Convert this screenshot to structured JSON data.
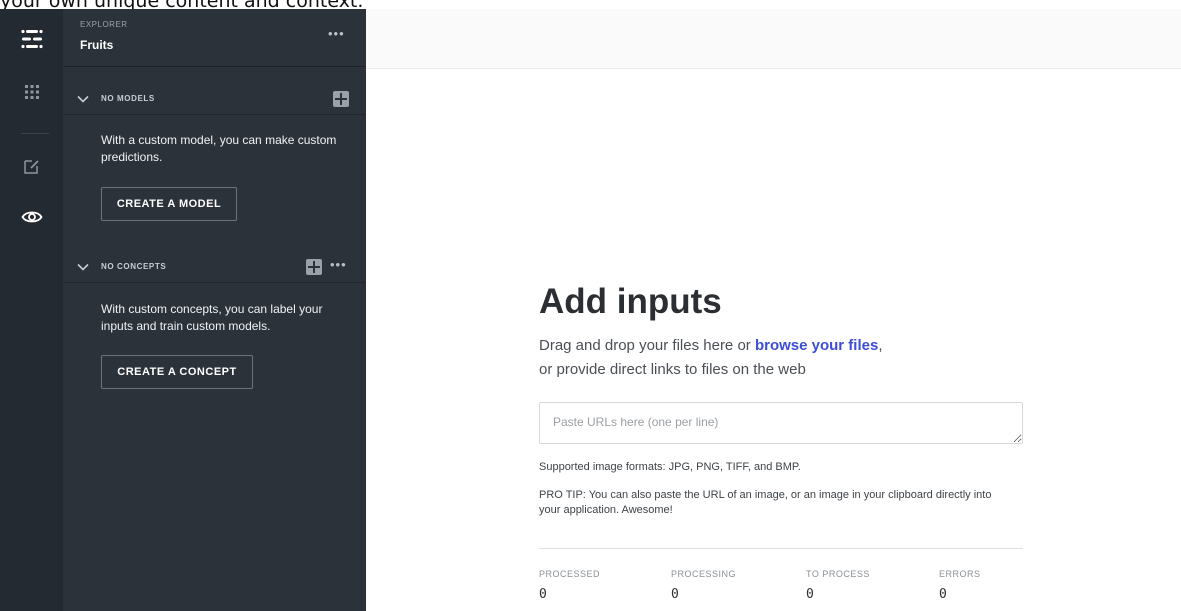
{
  "overlay_text": "your own unique content and context.",
  "panel": {
    "explorer_label": "EXPLORER",
    "app_name": "Fruits",
    "models": {
      "header": "NO MODELS",
      "description": "With a custom model, you can make custom predictions.",
      "button": "CREATE A MODEL"
    },
    "concepts": {
      "header": "NO CONCEPTS",
      "description": "With custom concepts, you can label your inputs and train custom models.",
      "button": "CREATE A CONCEPT"
    }
  },
  "main": {
    "title": "Add inputs",
    "desc_prefix": "Drag and drop your files here or",
    "browse_link": "browse your files",
    "desc_suffix": ",",
    "desc_line2": "or provide direct links to files on the web",
    "url_placeholder": "Paste URLs here (one per line)",
    "formats": "Supported image formats: JPG, PNG, TIFF, and BMP.",
    "protip": "PRO TIP: You can also paste the URL of an image, or an image in your clipboard directly into your application. Awesome!"
  },
  "stats": [
    {
      "label": "PROCESSED",
      "value": "0"
    },
    {
      "label": "PROCESSING",
      "value": "0"
    },
    {
      "label": "TO PROCESS",
      "value": "0"
    },
    {
      "label": "ERRORS",
      "value": "0"
    }
  ],
  "icons": {
    "logo": "logo-icon",
    "apps": "grid-icon",
    "edit": "edit-icon",
    "explorer": "eye-icon"
  },
  "colors": {
    "rail_bg": "#232a32",
    "panel_bg": "#2b323a",
    "link": "#3d4ed6"
  }
}
